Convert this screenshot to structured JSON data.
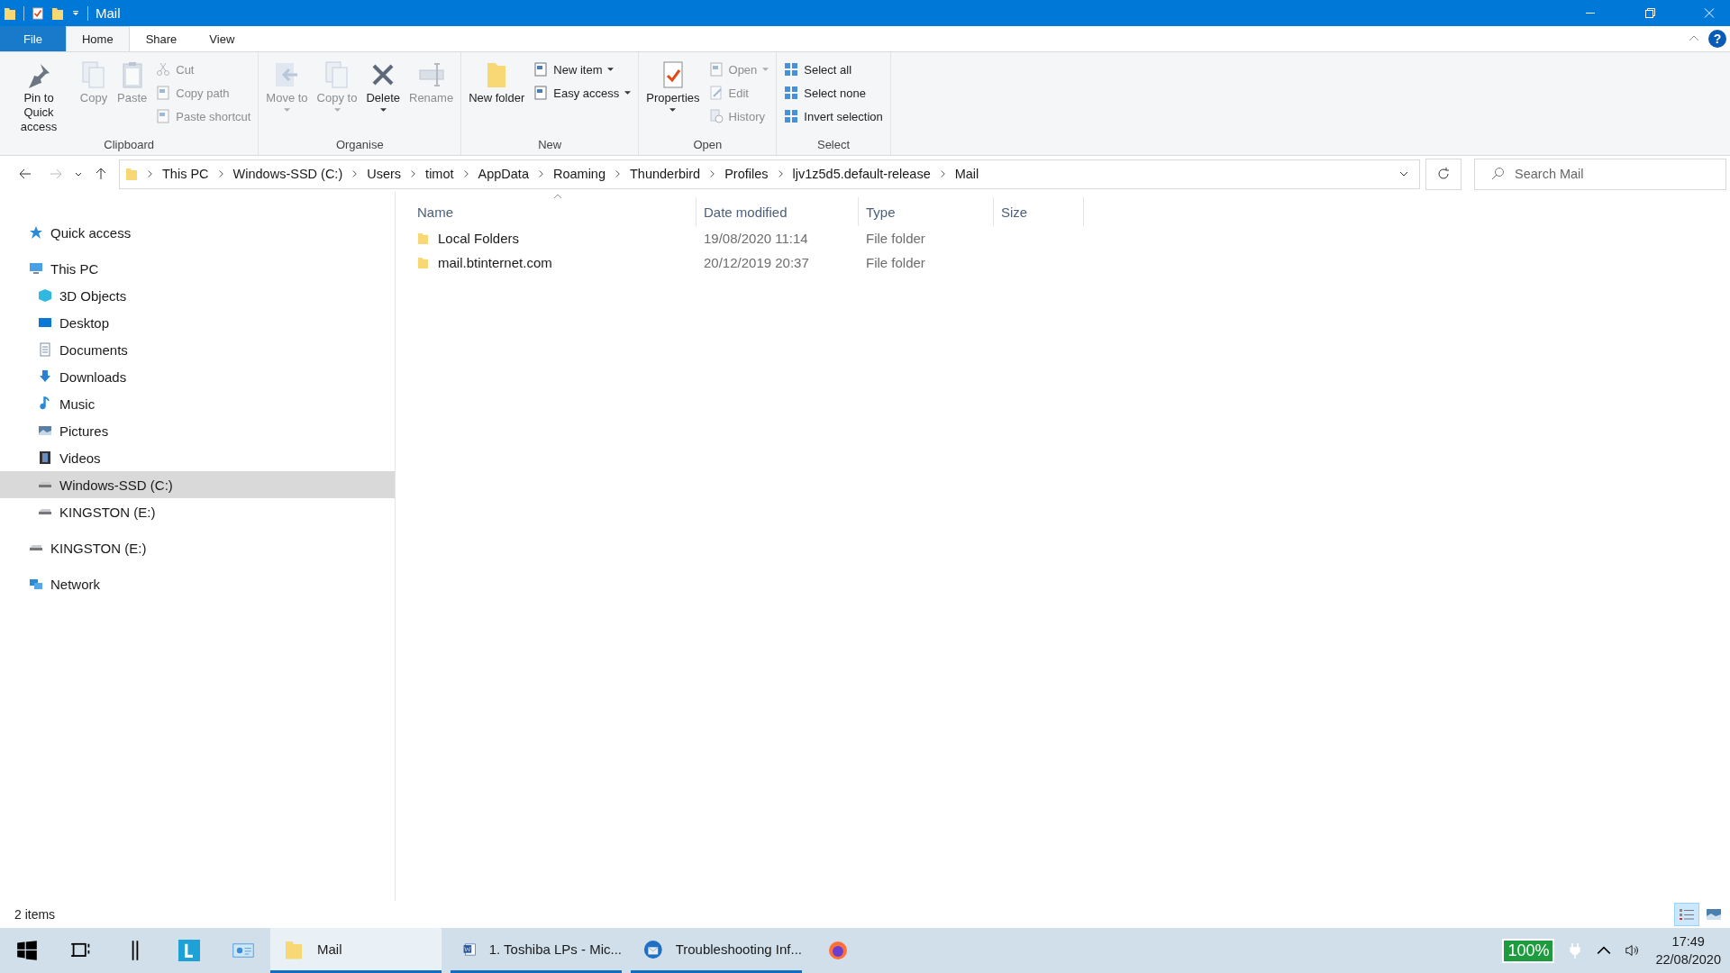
{
  "window": {
    "title": "Mail"
  },
  "tabs": [
    {
      "label": "File",
      "selected": false,
      "kind": "file"
    },
    {
      "label": "Home",
      "selected": true,
      "kind": "tab"
    },
    {
      "label": "Share",
      "selected": false,
      "kind": "tab"
    },
    {
      "label": "View",
      "selected": false,
      "kind": "tab"
    }
  ],
  "help": {
    "label": "?"
  },
  "ribbon": {
    "groups": [
      {
        "label": "Clipboard",
        "buttons": [
          {
            "label": "Pin to Quick access",
            "kind": "large",
            "disabled": false,
            "dropdown": false
          },
          {
            "label": "Copy",
            "kind": "large",
            "disabled": true,
            "dropdown": false
          },
          {
            "label": "Paste",
            "kind": "large",
            "disabled": true,
            "dropdown": false
          },
          {
            "label": "Cut",
            "kind": "small",
            "disabled": true,
            "dropdown": false
          },
          {
            "label": "Copy path",
            "kind": "small",
            "disabled": true,
            "dropdown": false
          },
          {
            "label": "Paste shortcut",
            "kind": "small",
            "disabled": true,
            "dropdown": false
          }
        ]
      },
      {
        "label": "Organise",
        "buttons": [
          {
            "label": "Move to",
            "kind": "large",
            "disabled": true,
            "dropdown": true
          },
          {
            "label": "Copy to",
            "kind": "large",
            "disabled": true,
            "dropdown": true
          },
          {
            "label": "Delete",
            "kind": "large",
            "disabled": false,
            "dropdown": true
          },
          {
            "label": "Rename",
            "kind": "large",
            "disabled": true,
            "dropdown": false
          }
        ]
      },
      {
        "label": "New",
        "buttons": [
          {
            "label": "New folder",
            "kind": "large",
            "disabled": false,
            "dropdown": false
          },
          {
            "label": "New item",
            "kind": "small",
            "disabled": false,
            "dropdown": true
          },
          {
            "label": "Easy access",
            "kind": "small",
            "disabled": false,
            "dropdown": true
          }
        ]
      },
      {
        "label": "Open",
        "buttons": [
          {
            "label": "Properties",
            "kind": "large",
            "disabled": false,
            "dropdown": true
          },
          {
            "label": "Open",
            "kind": "small",
            "disabled": true,
            "dropdown": true
          },
          {
            "label": "Edit",
            "kind": "small",
            "disabled": true,
            "dropdown": false
          },
          {
            "label": "History",
            "kind": "small",
            "disabled": true,
            "dropdown": false
          }
        ]
      },
      {
        "label": "Select",
        "buttons": [
          {
            "label": "Select all",
            "kind": "small",
            "disabled": false,
            "dropdown": false
          },
          {
            "label": "Select none",
            "kind": "small",
            "disabled": false,
            "dropdown": false
          },
          {
            "label": "Invert selection",
            "kind": "small",
            "disabled": false,
            "dropdown": false
          }
        ]
      }
    ]
  },
  "address": {
    "path": [
      "This PC",
      "Windows-SSD (C:)",
      "Users",
      "timot",
      "AppData",
      "Roaming",
      "Thunderbird",
      "Profiles",
      "ljv1z5d5.default-release",
      "Mail"
    ]
  },
  "search": {
    "placeholder": "Search Mail"
  },
  "sidebar": {
    "items": [
      {
        "label": "Quick access",
        "selected": false
      },
      {
        "label": "This PC",
        "selected": false,
        "children": [
          {
            "label": "3D Objects",
            "selected": false
          },
          {
            "label": "Desktop",
            "selected": false
          },
          {
            "label": "Documents",
            "selected": false
          },
          {
            "label": "Downloads",
            "selected": false
          },
          {
            "label": "Music",
            "selected": false
          },
          {
            "label": "Pictures",
            "selected": false
          },
          {
            "label": "Videos",
            "selected": false
          },
          {
            "label": "Windows-SSD (C:)",
            "selected": true
          },
          {
            "label": "KINGSTON (E:)",
            "selected": false
          }
        ]
      },
      {
        "label": "KINGSTON (E:)",
        "selected": false
      },
      {
        "label": "Network",
        "selected": false
      }
    ]
  },
  "table": {
    "columns": [
      {
        "label": "Name",
        "sorted": true
      },
      {
        "label": "Date modified",
        "sorted": false
      },
      {
        "label": "Type",
        "sorted": false
      },
      {
        "label": "Size",
        "sorted": false
      }
    ],
    "rows": [
      {
        "name": "Local Folders",
        "date": "19/08/2020 11:14",
        "type": "File folder"
      },
      {
        "name": "mail.btinternet.com",
        "date": "20/12/2019 20:37",
        "type": "File folder"
      }
    ]
  },
  "status_bar": {
    "text": "2 items",
    "views": [
      {
        "selected": true
      },
      {
        "selected": false
      }
    ]
  },
  "taskbar": {
    "windows": [
      {
        "label": "Mail",
        "selected": true
      },
      {
        "label": "1. Toshiba LPs - Mic...",
        "selected": false
      },
      {
        "label": "Troubleshooting Inf...",
        "selected": false
      }
    ],
    "battery": "100%",
    "time": "17:49",
    "date": "22/08/2020"
  }
}
